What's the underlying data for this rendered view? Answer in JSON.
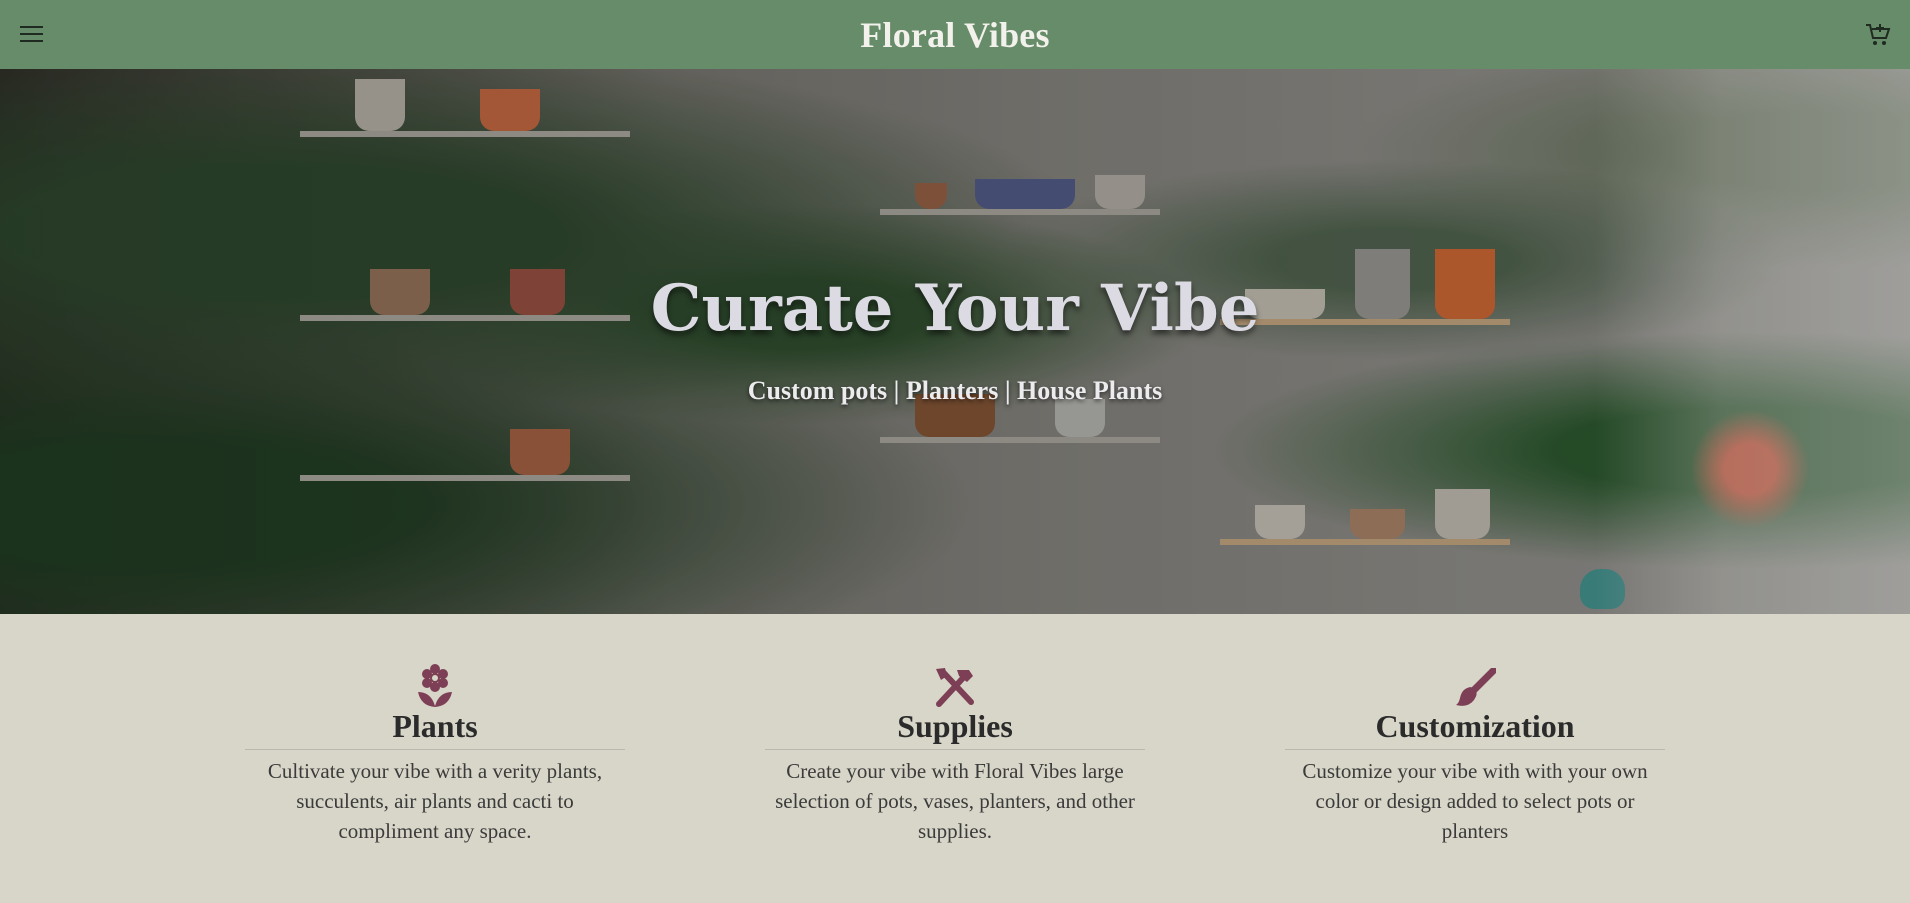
{
  "header": {
    "brand": "Floral Vibes",
    "menu_icon": "menu-icon",
    "cart_icon": "cart-icon"
  },
  "hero": {
    "title": "Curate Your Vibe",
    "subtitle": "Custom pots | Planters | House Plants"
  },
  "features": [
    {
      "icon": "flower-icon",
      "title": "Plants",
      "text": "Cultivate your vibe with a verity plants, succulents, air plants and cacti to compliment any space."
    },
    {
      "icon": "tools-icon",
      "title": "Supplies",
      "text": "Create your vibe with Floral Vibes large selection of pots, vases, planters, and other supplies."
    },
    {
      "icon": "paintbrush-icon",
      "title": "Customization",
      "text": "Customize your vibe with with your own color or design added to select pots or planters"
    }
  ],
  "colors": {
    "header_bg": "#678c69",
    "page_bg": "#d8d6c8",
    "accent": "#7d3f55"
  }
}
